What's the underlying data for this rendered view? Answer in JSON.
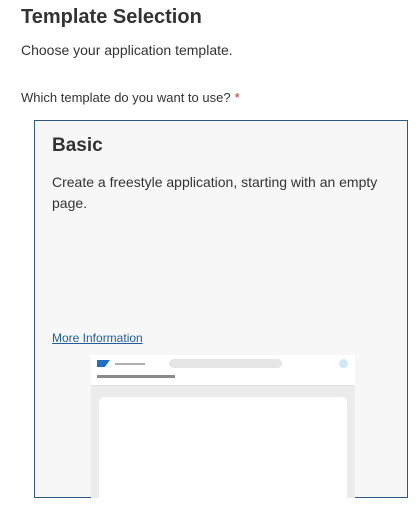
{
  "header": {
    "title": "Template Selection",
    "subtitle": "Choose your application template."
  },
  "form": {
    "question": "Which template do you want to use?",
    "required_mark": "*"
  },
  "template_card": {
    "title": "Basic",
    "description": "Create a freestyle application, starting with an empty page.",
    "link_label": "More Information",
    "selected": true,
    "border_color": "#2d5a83",
    "preview": {
      "logo_icon": "sap-logo-icon",
      "avatar_icon": "avatar-icon"
    }
  },
  "colors": {
    "link": "#1f5e9a",
    "required": "#c62828",
    "card_background": "#f7f7f7"
  }
}
